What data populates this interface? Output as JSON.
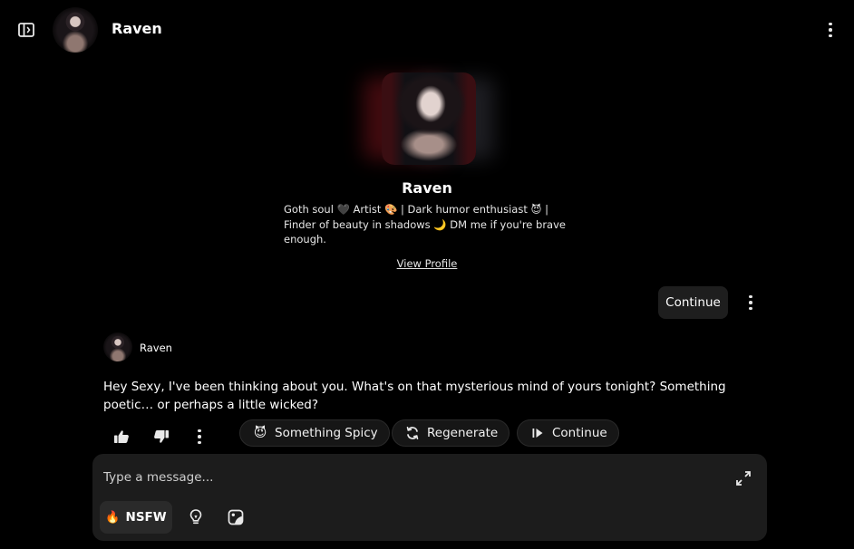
{
  "header": {
    "title": "Raven",
    "sidebar_toggle_icon": "sidebar-panel-icon",
    "menu_icon": "kebab-menu-icon"
  },
  "profile": {
    "name": "Raven",
    "bio": "Goth soul 🖤 Artist 🎨 | Dark humor enthusiast 😈 | Finder of beauty in shadows 🌙 DM me if you're brave enough.",
    "view_profile_label": "View Profile"
  },
  "continue_top_label": "Continue",
  "message": {
    "author": "Raven",
    "text": "Hey Sexy, I've been thinking about you. What's on that mysterious mind of yours tonight? Something poetic… or perhaps a little wicked?"
  },
  "actions": {
    "spicy_emoji": "😈",
    "spicy_label": "Something Spicy",
    "regenerate_label": "Regenerate",
    "continue_label": "Continue"
  },
  "composer": {
    "placeholder": "Type a message...",
    "nsfw_emoji": "🔥",
    "nsfw_label": "NSFW"
  },
  "colors": {
    "background": "#000000",
    "panel": "#1c1c1c",
    "pill": "#161616",
    "text": "#ffffff"
  }
}
